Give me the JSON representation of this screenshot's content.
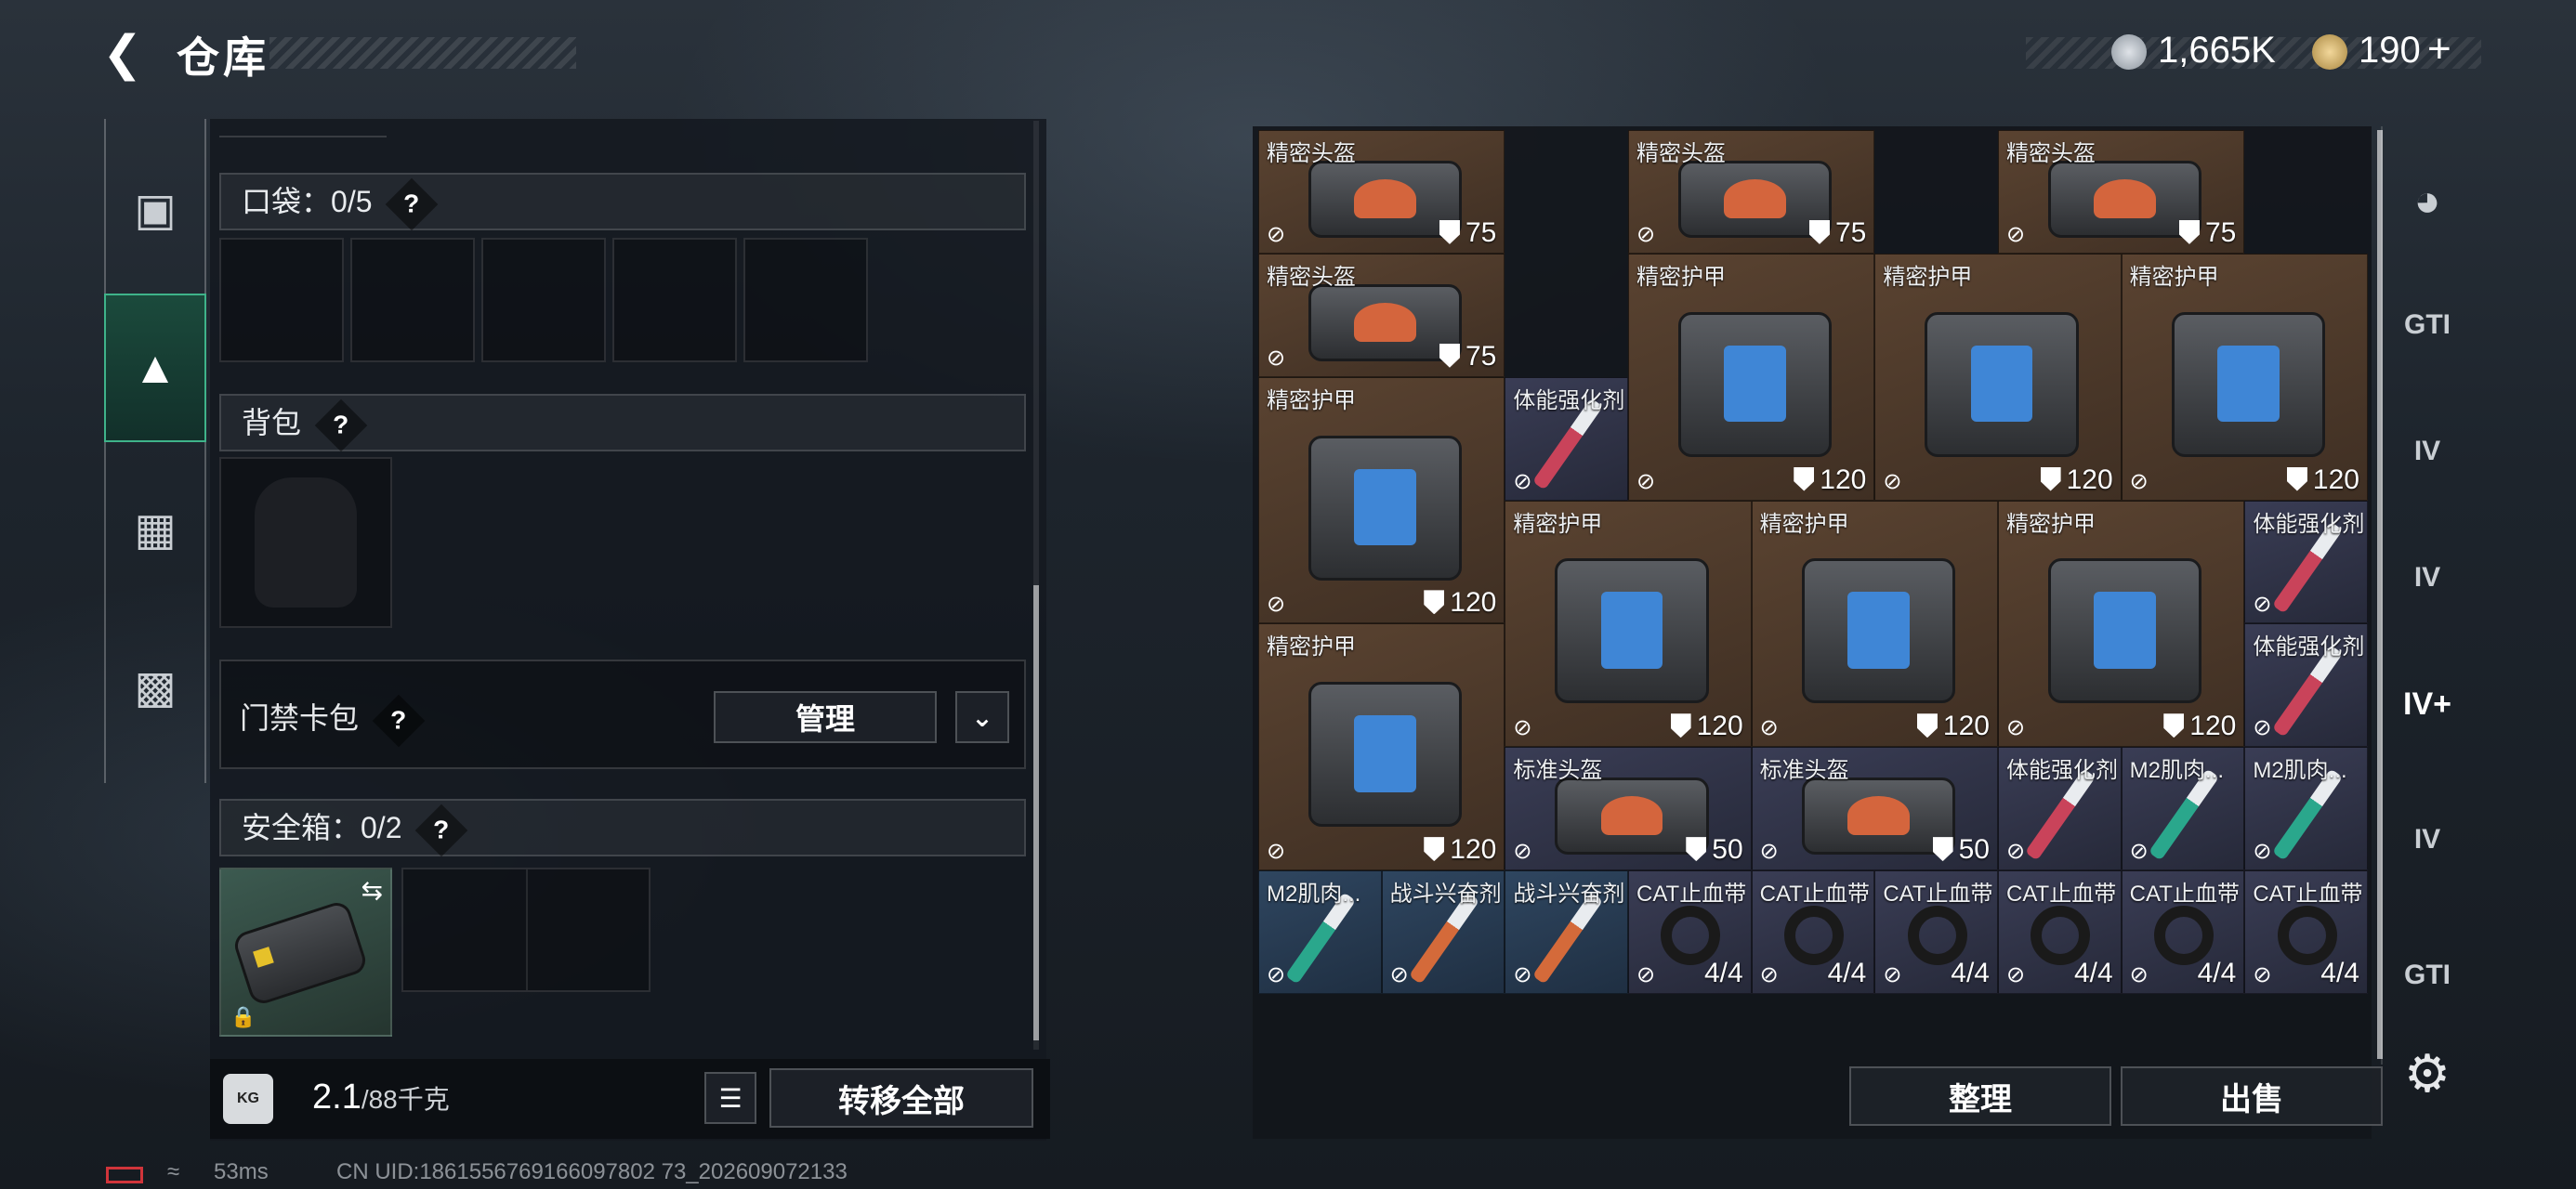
{
  "header": {
    "back_icon": "back-arrow-icon",
    "title": "仓库"
  },
  "currency": {
    "silver": "1,665K",
    "gold": "190",
    "gold_plus": "+"
  },
  "left_tabs": [
    "gun-icon",
    "backpack-icon",
    "vest-icon",
    "toolbox-icon"
  ],
  "pocket": {
    "label": "口袋：",
    "count": "0",
    "sep": "/",
    "max": "5",
    "help": "?"
  },
  "backpack": {
    "label": "背包",
    "help": "?"
  },
  "keycard": {
    "label": "门禁卡包",
    "help": "?",
    "manage": "管理"
  },
  "safebox": {
    "label": "安全箱：0/2",
    "help": "?"
  },
  "bottom": {
    "weight": "2.1",
    "weight_max": "/88千克",
    "transfer_all": "转移全部"
  },
  "grid_actions": {
    "sort": "整理",
    "sell": "出售"
  },
  "items": [
    {
      "name": "精密头盔",
      "value": "75",
      "kind": "helmet"
    },
    {
      "name": "精密头盔",
      "value": "75",
      "kind": "helmet"
    },
    {
      "name": "精密头盔",
      "value": "75",
      "kind": "helmet"
    },
    {
      "name": "精密头盔",
      "value": "75",
      "kind": "helmet"
    },
    {
      "name": "精密护甲",
      "value": "120",
      "kind": "armor"
    },
    {
      "name": "精密护甲",
      "value": "120",
      "kind": "armor"
    },
    {
      "name": "精密护甲",
      "value": "120",
      "kind": "armor"
    },
    {
      "name": "精密护甲",
      "value": "120",
      "kind": "armor"
    },
    {
      "name": "体能强化剂",
      "value": "",
      "kind": "syringe"
    },
    {
      "name": "精密护甲",
      "value": "120",
      "kind": "armor"
    },
    {
      "name": "精密护甲",
      "value": "120",
      "kind": "armor"
    },
    {
      "name": "精密护甲",
      "value": "120",
      "kind": "armor"
    },
    {
      "name": "体能强化剂",
      "value": "",
      "kind": "syringe"
    },
    {
      "name": "精密护甲",
      "value": "120",
      "kind": "armor"
    },
    {
      "name": "体能强化剂",
      "value": "",
      "kind": "syringe"
    },
    {
      "name": "标准头盔",
      "value": "50",
      "kind": "helmet"
    },
    {
      "name": "标准头盔",
      "value": "50",
      "kind": "helmet"
    },
    {
      "name": "体能强化剂",
      "value": "",
      "kind": "syringe"
    },
    {
      "name": "M2肌肉...",
      "value": "",
      "kind": "syringe"
    },
    {
      "name": "M2肌肉...",
      "value": "",
      "kind": "syringe"
    },
    {
      "name": "M2肌肉...",
      "value": "",
      "kind": "syringe"
    },
    {
      "name": "战斗兴奋剂",
      "value": "",
      "kind": "syringe"
    },
    {
      "name": "战斗兴奋剂",
      "value": "",
      "kind": "syringe"
    },
    {
      "name": "CAT止血带",
      "value": "4/4",
      "kind": "tourniquet"
    },
    {
      "name": "CAT止血带",
      "value": "4/4",
      "kind": "tourniquet"
    },
    {
      "name": "CAT止血带",
      "value": "4/4",
      "kind": "tourniquet"
    },
    {
      "name": "CAT止血带",
      "value": "4/4",
      "kind": "tourniquet"
    },
    {
      "name": "CAT止血带",
      "value": "4/4",
      "kind": "tourniquet"
    },
    {
      "name": "CAT止血带",
      "value": "4/4",
      "kind": "tourniquet"
    }
  ],
  "right_tabs": [
    {
      "icon": "helmet-icon",
      "label": ""
    },
    {
      "icon": "gti-box-icon",
      "label": "GTI"
    },
    {
      "icon": "iv-box-icon",
      "label": "IV"
    },
    {
      "icon": "iv-box-icon",
      "label": "IV"
    },
    {
      "icon": "iv-add-icon",
      "label": "IV+"
    },
    {
      "icon": "iv-box-icon",
      "label": "IV"
    },
    {
      "icon": "gti-box-icon",
      "label": "GTI"
    },
    {
      "icon": "settings-gear-icon",
      "label": "⚙"
    }
  ],
  "footer": {
    "ping": "53ms",
    "uid": "CN UID:1861556769166097802 73_202609072133"
  }
}
